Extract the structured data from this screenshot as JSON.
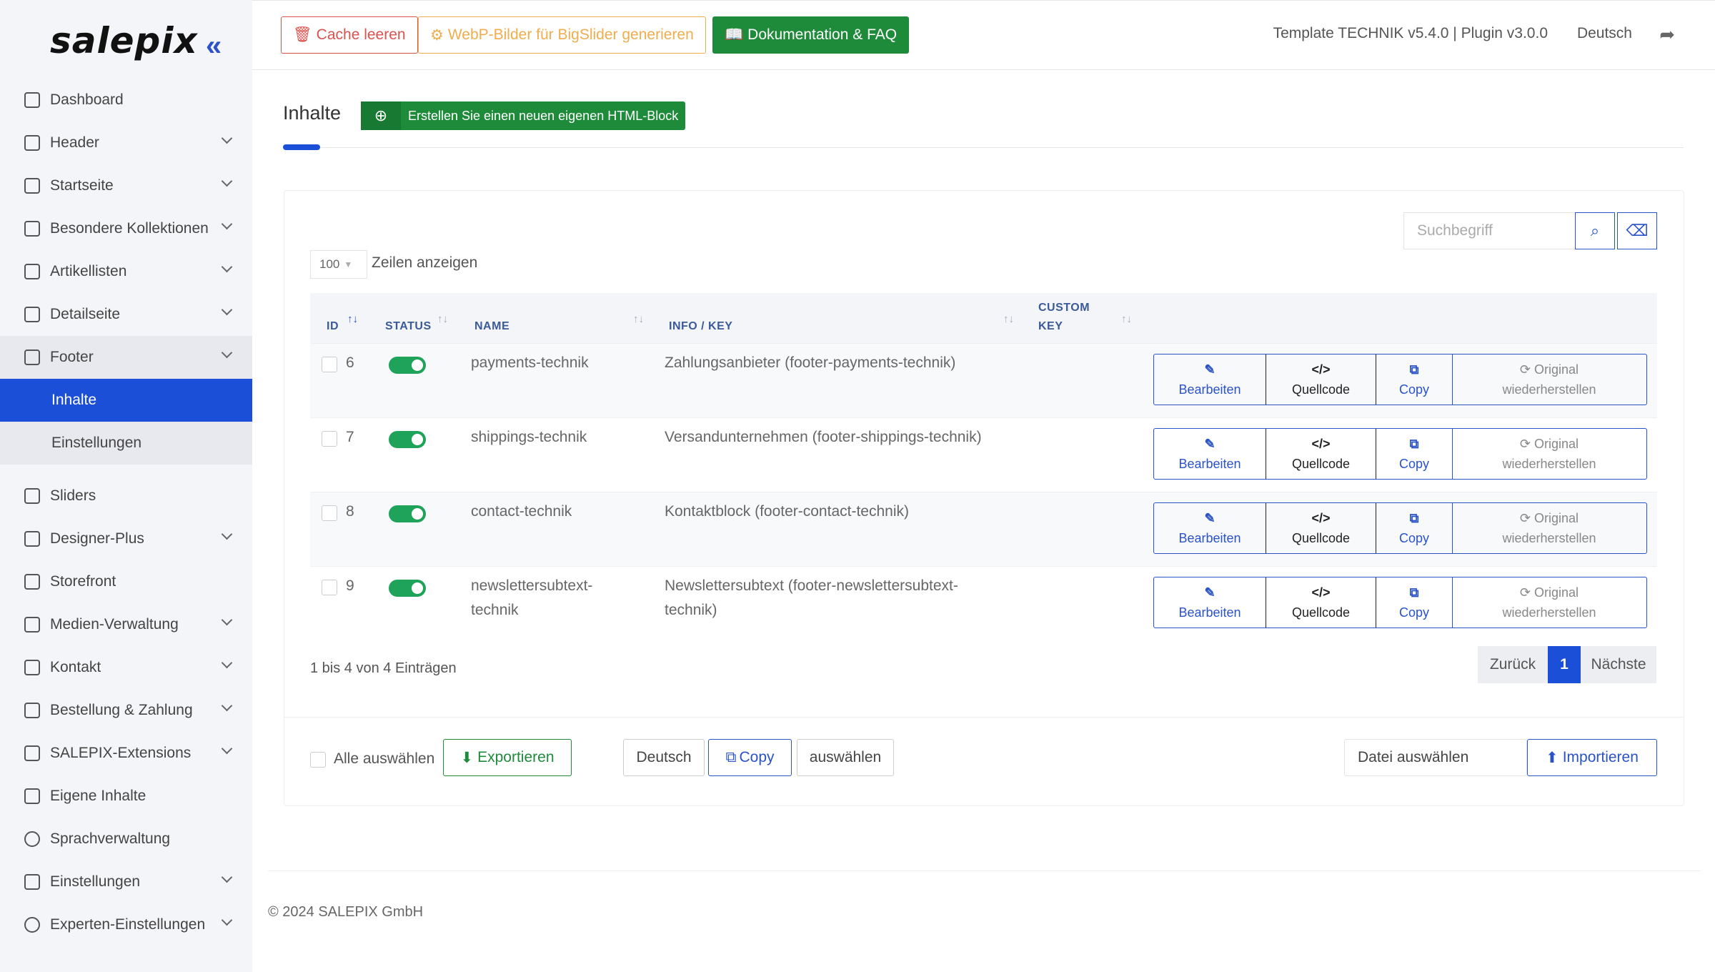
{
  "brand": {
    "logo": "salepix"
  },
  "sidebar": {
    "items": [
      {
        "label": "Dashboard"
      },
      {
        "label": "Header"
      },
      {
        "label": "Startseite"
      },
      {
        "label": "Besondere Kollektionen"
      },
      {
        "label": "Artikellisten"
      },
      {
        "label": "Detailseite"
      },
      {
        "label": "Footer"
      },
      {
        "label": "Sliders"
      },
      {
        "label": "Designer-Plus"
      },
      {
        "label": "Storefront"
      },
      {
        "label": "Medien-Verwaltung"
      },
      {
        "label": "Kontakt"
      },
      {
        "label": "Bestellung & Zahlung"
      },
      {
        "label": "SALEPIX-Extensions"
      },
      {
        "label": "Eigene Inhalte"
      },
      {
        "label": "Sprachverwaltung"
      },
      {
        "label": "Einstellungen"
      },
      {
        "label": "Experten-Einstellungen"
      }
    ],
    "footer_sub": [
      {
        "label": "Inhalte"
      },
      {
        "label": "Einstellungen"
      }
    ]
  },
  "toolbar": {
    "cache": "Cache leeren",
    "webp": "WebP-Bilder für BigSlider generieren",
    "docs": "Dokumentation & FAQ",
    "version": "Template TECHNIK v5.4.0 | Plugin v3.0.0",
    "language": "Deutsch"
  },
  "page": {
    "title": "Inhalte",
    "create": "Erstellen Sie einen neuen eigenen HTML-Block"
  },
  "search": {
    "placeholder": "Suchbegriff"
  },
  "table": {
    "page_size": "100",
    "page_size_label": "Zeilen anzeigen",
    "headers": {
      "id": "ID",
      "status": "STATUS",
      "name": "NAME",
      "info": "INFO / KEY",
      "custom1": "CUSTOM",
      "custom2": "KEY"
    },
    "rows": [
      {
        "id": "6",
        "name": "payments-technik",
        "name2": "",
        "info": "Zahlungsanbieter (footer-payments-technik)",
        "info2": ""
      },
      {
        "id": "7",
        "name": "shippings-technik",
        "name2": "",
        "info": "Versandunternehmen (footer-shippings-technik)",
        "info2": ""
      },
      {
        "id": "8",
        "name": "contact-technik",
        "name2": "",
        "info": "Kontaktblock (footer-contact-technik)",
        "info2": ""
      },
      {
        "id": "9",
        "name": "newslettersubtext-",
        "name2": "technik",
        "info": "Newslettersubtext (footer-newslettersubtext-",
        "info2": "technik)"
      }
    ],
    "actions": {
      "edit": "Bearbeiten",
      "source": "Quellcode",
      "copy": "Copy",
      "restore1": "Original",
      "restore2": "wiederherstellen"
    },
    "summary": "1 bis 4 von 4 Einträgen",
    "pager": {
      "prev": "Zurück",
      "page": "1",
      "next": "Nächste"
    }
  },
  "footer_actions": {
    "select_all": "Alle auswählen",
    "export": "Exportieren",
    "lang": "Deutsch",
    "copy": "Copy",
    "choose": "auswählen",
    "file": "Datei auswählen",
    "import": "Importieren"
  },
  "copyright": "© 2024 SALEPIX GmbH",
  "colors": {
    "primary": "#1c4fd8",
    "success": "#1e8b3a",
    "danger": "#d9534f",
    "warning": "#f0ad4e"
  }
}
